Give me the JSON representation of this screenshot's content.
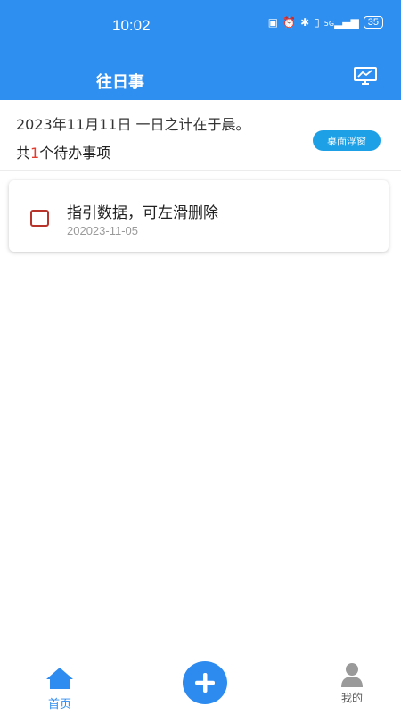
{
  "status_bar": {
    "time": "10:02",
    "battery": "35",
    "signal": "5G"
  },
  "header": {
    "title": "往日事"
  },
  "summary": {
    "date_text": "2023年11月11日 一日之计在于晨。",
    "count_prefix": "共",
    "count": "1",
    "count_suffix": "个待办事项",
    "float_button": "桌面浮窗"
  },
  "todos": [
    {
      "title": "指引数据，可左滑删除",
      "date": "202023-11-05",
      "checked": false
    }
  ],
  "bottom_nav": {
    "home_label": "首页",
    "mine_label": "我的"
  },
  "colors": {
    "primary": "#2f8ff0",
    "count_highlight": "#e23c2e",
    "checkbox_border": "#b8332a",
    "float_button_bg": "#1ea0e6"
  }
}
